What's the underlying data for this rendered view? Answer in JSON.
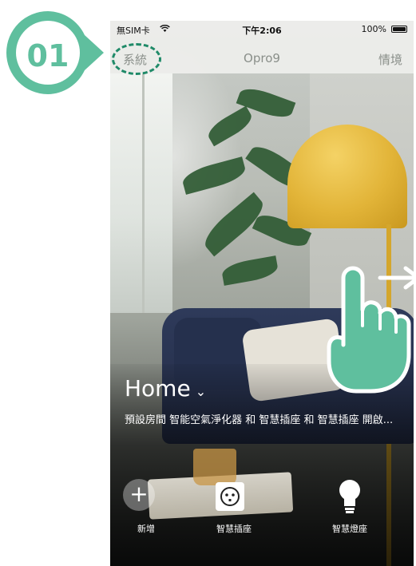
{
  "step": {
    "number": "01"
  },
  "status_bar": {
    "carrier": "無SIM卡",
    "time": "下午2:06",
    "battery": "100%",
    "battery_level": 1.0
  },
  "nav": {
    "left": "系統",
    "title": "Opro9",
    "right": "情境"
  },
  "home": {
    "title": "Home",
    "description": "預設房間 智能空氣淨化器 和 智慧插座 和 智慧插座 開啟..."
  },
  "devices": [
    {
      "label": "新增",
      "icon": "plus-icon"
    },
    {
      "label": "智慧插座",
      "icon": "smart-plug-icon"
    },
    {
      "label": "智慧燈座",
      "icon": "lightbulb-icon"
    }
  ],
  "colors": {
    "accent": "#5fbf9e",
    "accent_dark": "#1f8a68",
    "lamp": "#e2b438",
    "sofa": "#2e3a5a"
  }
}
